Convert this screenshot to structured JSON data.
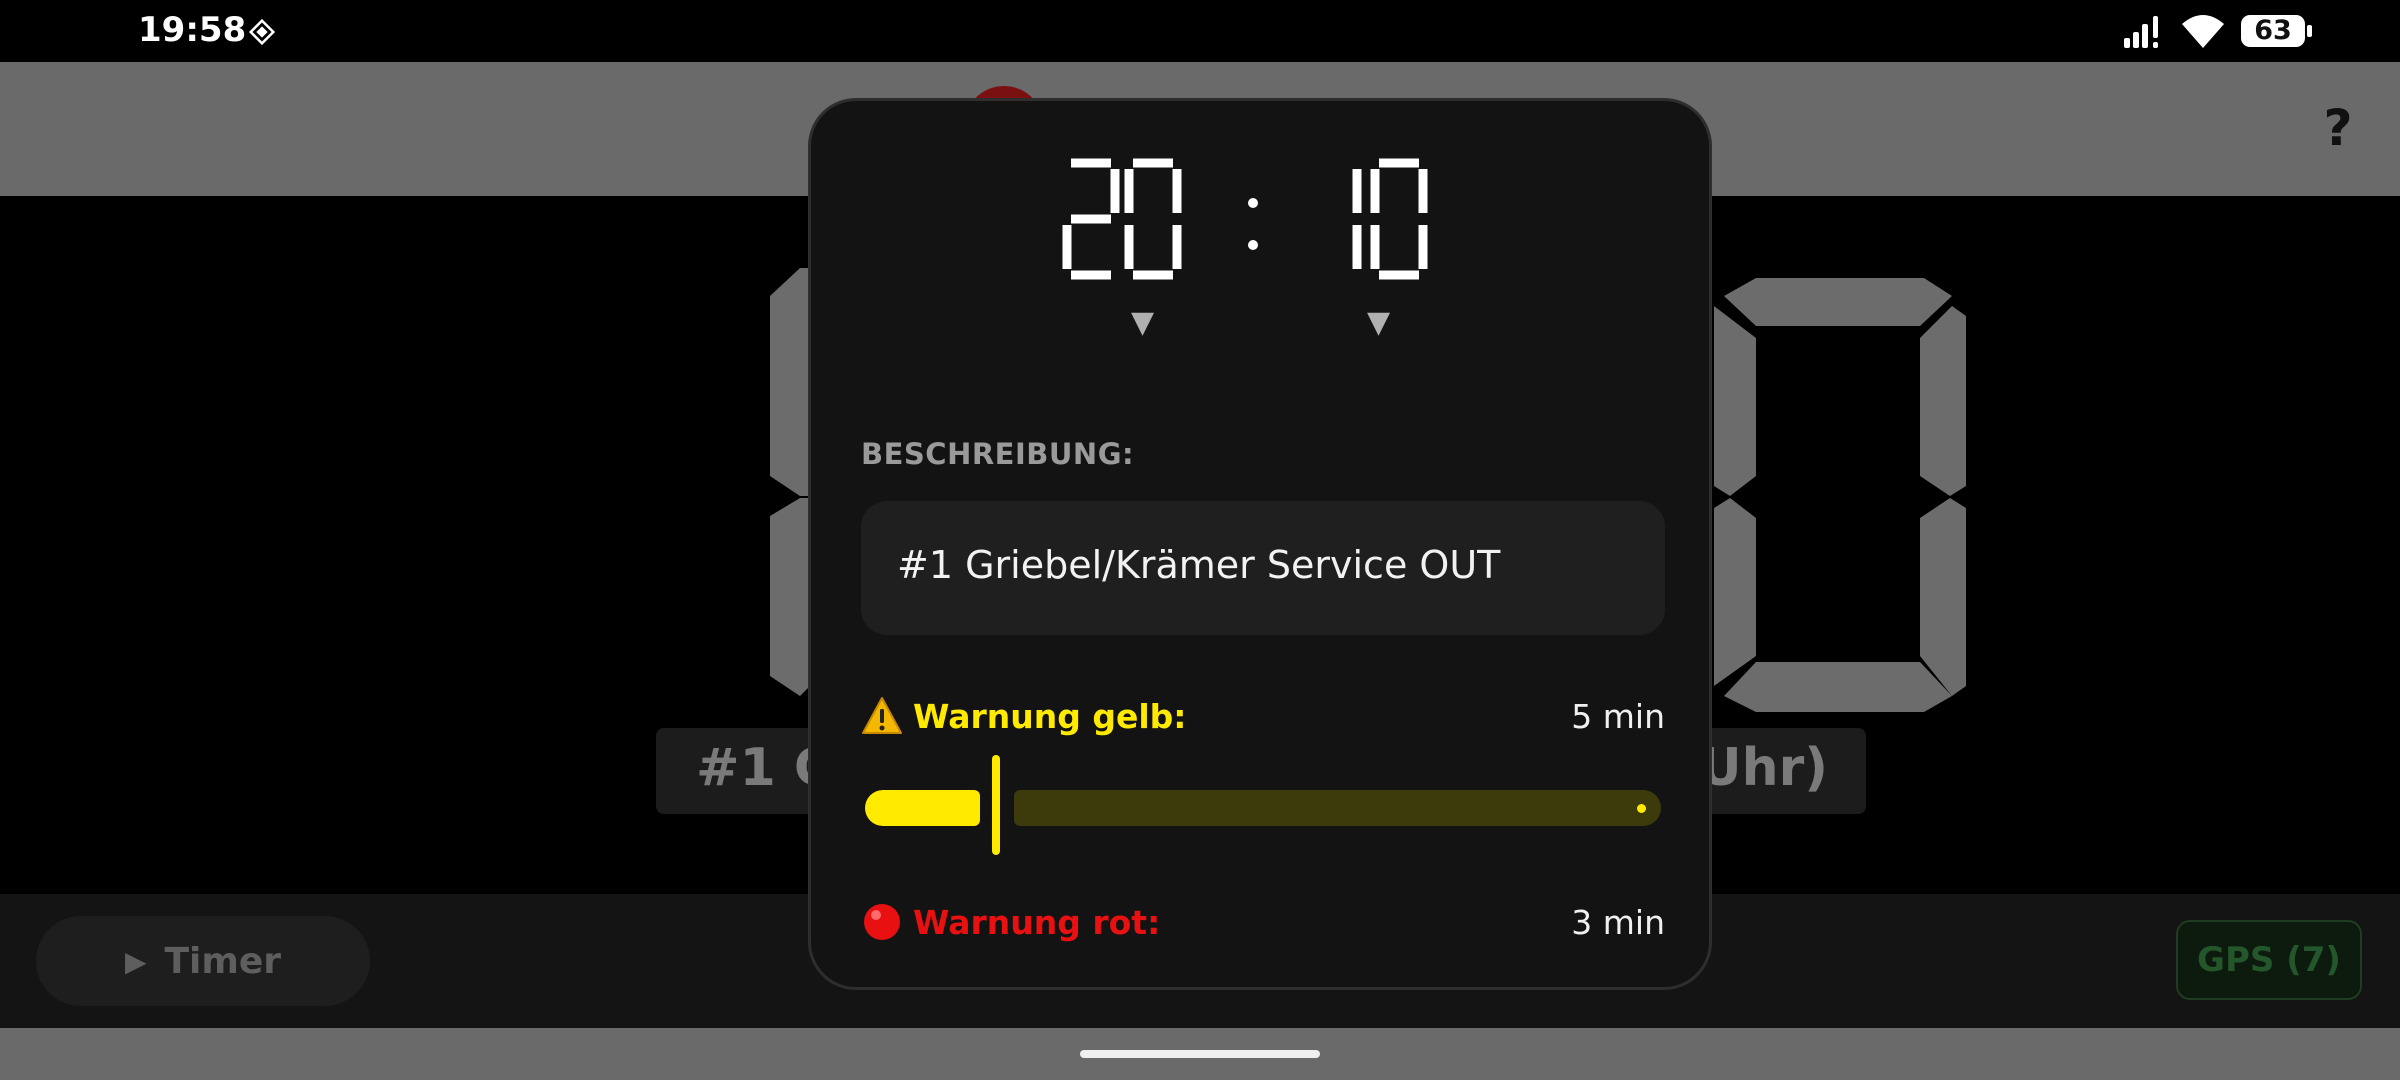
{
  "status_bar": {
    "time": "19:58",
    "battery": "63",
    "icons": [
      "notification-icon",
      "signal-icon",
      "wifi-icon",
      "battery-icon"
    ]
  },
  "app_bar": {
    "help_label": "?"
  },
  "background": {
    "label_left": "#1 G",
    "label_right": "Uhr)"
  },
  "bottom_bar": {
    "timer_label": "Timer",
    "gps_label": "GPS (7)"
  },
  "dialog": {
    "hours": "20",
    "minutes": "10",
    "description_label": "BESCHREIBUNG:",
    "description_value": "#1 Griebel/Krämer Service OUT",
    "warning_yellow": {
      "label": "Warnung gelb:",
      "value": "5 min",
      "slider_fraction": 0.16
    },
    "warning_red": {
      "label": "Warnung rot:",
      "value": "3 min"
    }
  },
  "colors": {
    "accent_yellow": "#ffea00",
    "accent_red": "#e81010",
    "dialog_bg": "#131313",
    "app_bar": "#6a6a6a"
  }
}
